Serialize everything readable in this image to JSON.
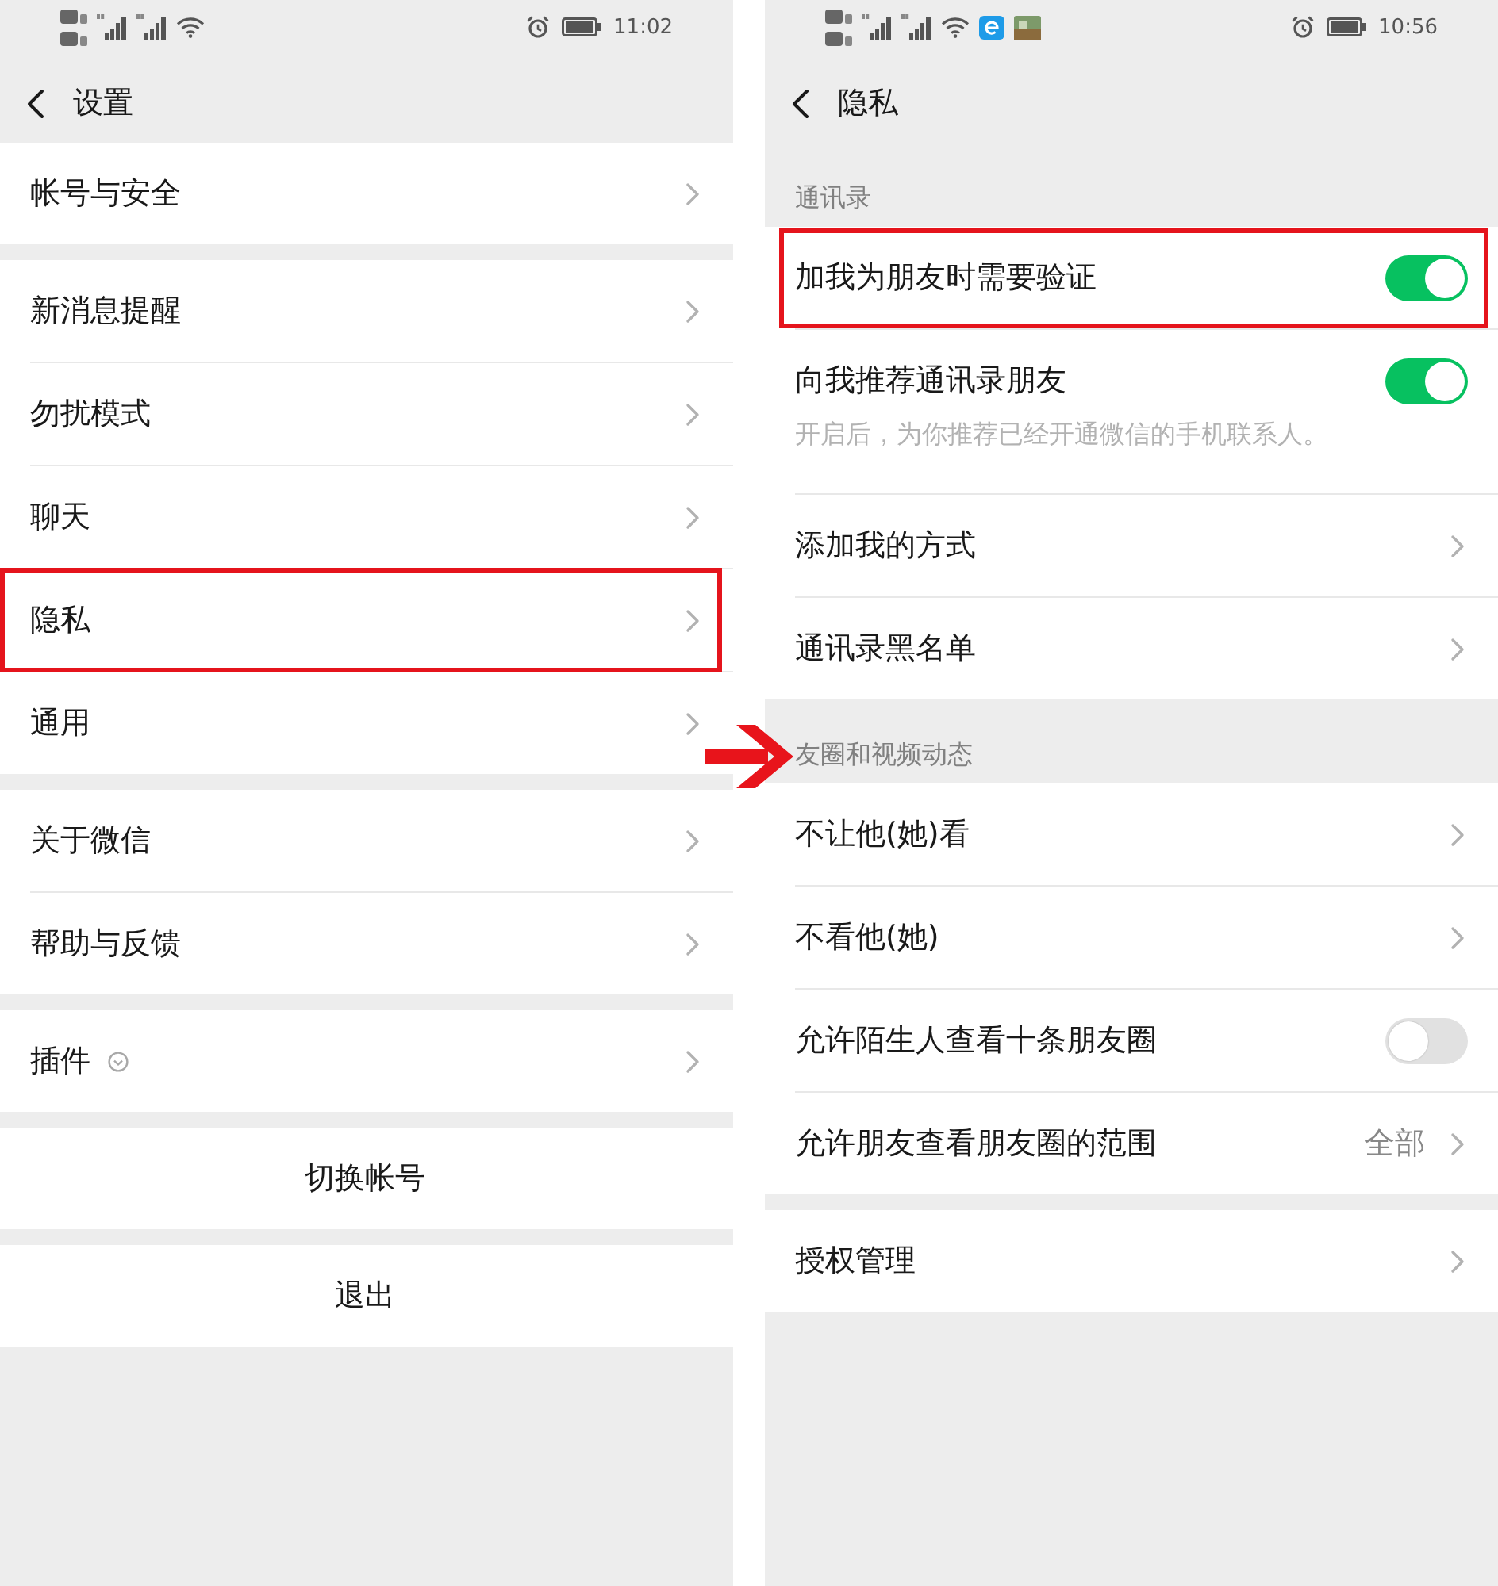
{
  "screens": [
    {
      "status_bar": {
        "time": "11:02"
      },
      "nav": {
        "title": "设置"
      },
      "groups": [
        {
          "rows": [
            {
              "kind": "link",
              "label": "帐号与安全",
              "highlighted": false
            }
          ]
        },
        {
          "rows": [
            {
              "kind": "link",
              "label": "新消息提醒",
              "highlighted": false
            },
            {
              "kind": "link",
              "label": "勿扰模式",
              "highlighted": false
            },
            {
              "kind": "link",
              "label": "聊天",
              "highlighted": false
            },
            {
              "kind": "link",
              "label": "隐私",
              "highlighted": true
            },
            {
              "kind": "link",
              "label": "通用",
              "highlighted": false
            }
          ]
        },
        {
          "rows": [
            {
              "kind": "link",
              "label": "关于微信",
              "highlighted": false
            },
            {
              "kind": "link",
              "label": "帮助与反馈",
              "highlighted": false
            }
          ]
        },
        {
          "rows": [
            {
              "kind": "plugin",
              "label": "插件",
              "highlighted": false
            }
          ]
        },
        {
          "rows": [
            {
              "kind": "action",
              "label": "切换帐号",
              "highlighted": false
            }
          ]
        },
        {
          "rows": [
            {
              "kind": "action",
              "label": "退出",
              "highlighted": false
            }
          ]
        }
      ]
    },
    {
      "status_bar": {
        "time": "10:56",
        "app_notifications": [
          {
            "kind": "browser"
          },
          {
            "kind": "image"
          }
        ]
      },
      "nav": {
        "title": "隐私"
      },
      "groups": [
        {
          "header": "通讯录",
          "rows": [
            {
              "kind": "toggle",
              "label": "加我为朋友时需要验证",
              "on": true,
              "highlighted": true
            },
            {
              "kind": "toggle",
              "label": "向我推荐通讯录朋友",
              "on": true,
              "description": "开启后，为你推荐已经开通微信的手机联系人。",
              "highlighted": false
            },
            {
              "kind": "link",
              "label": "添加我的方式",
              "highlighted": false
            },
            {
              "kind": "link",
              "label": "通讯录黑名单",
              "highlighted": false
            }
          ]
        },
        {
          "header": "友圈和视频动态",
          "rows": [
            {
              "kind": "link",
              "label": "不让他(她)看",
              "highlighted": false
            },
            {
              "kind": "link",
              "label": "不看他(她)",
              "highlighted": false
            },
            {
              "kind": "toggle",
              "label": "允许陌生人查看十条朋友圈",
              "on": false,
              "highlighted": false
            },
            {
              "kind": "value",
              "label": "允许朋友查看朋友圈的范围",
              "value": "全部",
              "highlighted": false
            }
          ]
        },
        {
          "rows": [
            {
              "kind": "link",
              "label": "授权管理",
              "highlighted": false
            }
          ]
        }
      ]
    }
  ],
  "arrow": true
}
